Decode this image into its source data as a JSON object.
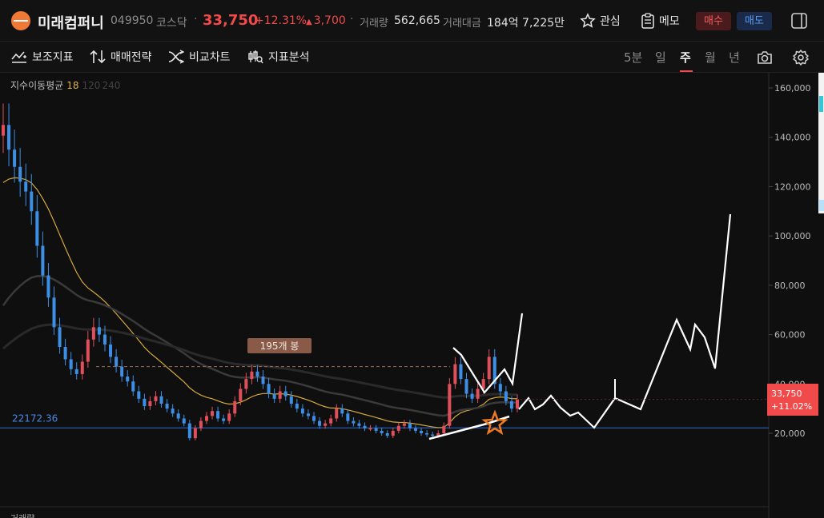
{
  "header": {
    "stock_name": "미래컴퍼니",
    "stock_code": "049950",
    "market": "코스닥",
    "price": "33,750",
    "change_rate": "+12.31%",
    "change_amount": "3,700",
    "volume_label": "거래량",
    "volume_value": "562,665",
    "amount_label": "거래대금",
    "amount_value": "184억 7,225만",
    "watch_label": "관심",
    "memo_label": "메모",
    "buy_label": "매수",
    "sell_label": "매도",
    "logo_color": "#f07a35",
    "up_color": "#f04a4a"
  },
  "toolbar": {
    "tools": [
      {
        "label": "보조지표",
        "icon": "indicator-icon"
      },
      {
        "label": "매매전략",
        "icon": "strategy-icon"
      },
      {
        "label": "비교차트",
        "icon": "compare-icon"
      },
      {
        "label": "지표분석",
        "icon": "analysis-icon"
      }
    ],
    "periods": [
      "5분",
      "일",
      "주",
      "월",
      "년"
    ],
    "active_period": "주"
  },
  "legend": {
    "title": "지수이동평균",
    "p1": "18",
    "p2": "120",
    "p3": "240"
  },
  "volume_pane_label": "거래량",
  "chart_data": {
    "type": "line",
    "title": "",
    "xlabel": "",
    "ylabel": "",
    "ylim": [
      0,
      170000
    ],
    "y_ticks": [
      "160,000",
      "140,000",
      "120,000",
      "100,000",
      "80,000",
      "60,000",
      "40,000",
      "20,000"
    ],
    "y_tick_values": [
      160000,
      140000,
      120000,
      100000,
      80000,
      60000,
      40000,
      20000
    ],
    "horizontal_line": {
      "label": "22172.36",
      "value": 22172.36,
      "color": "#2f6fd6"
    },
    "current_price": {
      "label": "33,750",
      "rate": "+11.02%",
      "value": 33750,
      "color": "#f04a4a"
    },
    "annotation": {
      "label": "195개 봉",
      "value": 47000
    },
    "up_color": "#e0505a",
    "down_color": "#3d8fe6",
    "ema_colors": [
      "#d4a93a",
      "#3a3a3a",
      "#2a2a2a"
    ],
    "series": [
      {
        "candles_close": [
          145000,
          135000,
          128000,
          122000,
          118000,
          110000,
          96000,
          84000,
          75000,
          63000,
          55000,
          50000,
          46000,
          44000,
          49000,
          58000,
          63000,
          60000,
          56000,
          51000,
          47000,
          43000,
          41000,
          37000,
          34000,
          31000,
          33000,
          35000,
          32000,
          30000,
          28000,
          26000,
          24000,
          18000,
          22000,
          25000,
          27000,
          29000,
          26000,
          25000,
          28000,
          33000,
          38000,
          42000,
          45000,
          43000,
          40000,
          36000,
          34000,
          37000,
          35000,
          32000,
          30000,
          28000,
          27000,
          25000,
          23000,
          24000,
          26000,
          30000,
          28000,
          25000,
          24000,
          23000,
          22000,
          22000,
          21000,
          20000,
          19000,
          21000,
          23000,
          24000,
          22000,
          21000,
          20000,
          19500,
          19000,
          20000,
          23000,
          40000,
          48000,
          42000,
          36000,
          34000,
          38000,
          42000,
          51000,
          40000,
          37000,
          33000,
          30000,
          33750
        ]
      }
    ],
    "drawings": {
      "projection_path": [
        [
          652,
          392
        ],
        [
          640,
          480
        ],
        [
          630,
          462
        ],
        [
          605,
          491
        ],
        [
          576,
          444
        ],
        [
          566,
          435
        ]
      ],
      "future_path": [
        [
          648,
          512
        ],
        [
          660,
          498
        ],
        [
          668,
          512
        ],
        [
          678,
          506
        ],
        [
          688,
          495
        ],
        [
          700,
          510
        ],
        [
          712,
          520
        ],
        [
          722,
          516
        ],
        [
          742,
          535
        ],
        [
          768,
          498
        ],
        [
          800,
          512
        ],
        [
          845,
          400
        ],
        [
          862,
          437
        ],
        [
          868,
          406
        ],
        [
          880,
          422
        ],
        [
          893,
          461
        ],
        [
          912,
          268
        ]
      ],
      "wedge": [
        [
          536,
          549
        ],
        [
          608,
          530
        ],
        [
          636,
          521
        ]
      ],
      "marker_stick": [
        [
          768,
          474
        ],
        [
          768,
          498
        ]
      ]
    }
  }
}
